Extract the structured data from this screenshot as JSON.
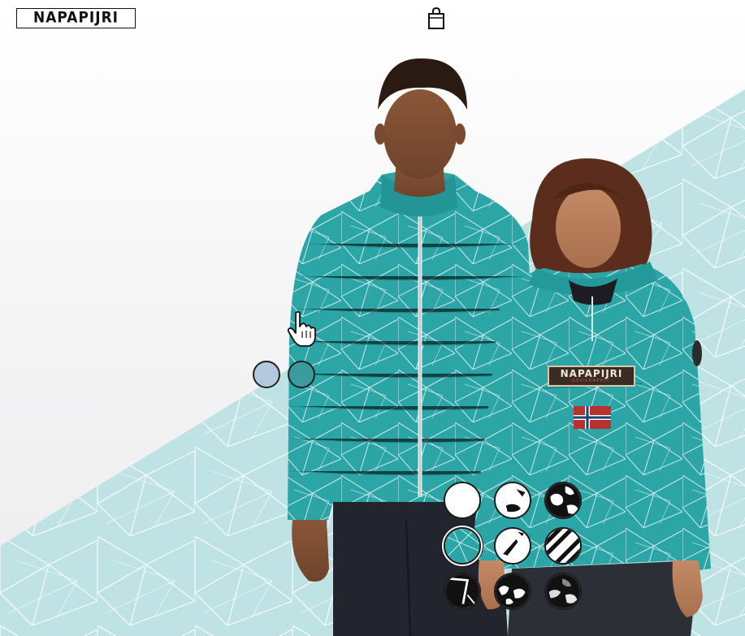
{
  "header": {
    "brand_logo": "NAPAPIJRI",
    "bag_icon": "shopping-bag-icon"
  },
  "jacket_badge": {
    "label": "NAPAPIJRI",
    "sub": "GEOGRAPHIC"
  },
  "color_options": [
    {
      "name": "light-blue",
      "color": "#b3c9e0",
      "selected": false
    },
    {
      "name": "teal",
      "color": "#3b9ca0",
      "selected": true
    }
  ],
  "pattern_options": [
    {
      "name": "plain-white",
      "selected": false
    },
    {
      "name": "white-black-corner",
      "selected": false
    },
    {
      "name": "black-white-splotches",
      "selected": false
    },
    {
      "name": "teal-geometric",
      "selected": true
    },
    {
      "name": "white-black-wedge",
      "selected": false
    },
    {
      "name": "black-white-stripes",
      "selected": false
    },
    {
      "name": "black-lines",
      "selected": false
    },
    {
      "name": "black-white-camo",
      "selected": false
    },
    {
      "name": "dark-grey-camo",
      "selected": false
    }
  ],
  "colors": {
    "jacket_teal": "#2ba5a6",
    "background_pattern": "#bfe2e4",
    "swatch_border": "#222222"
  }
}
